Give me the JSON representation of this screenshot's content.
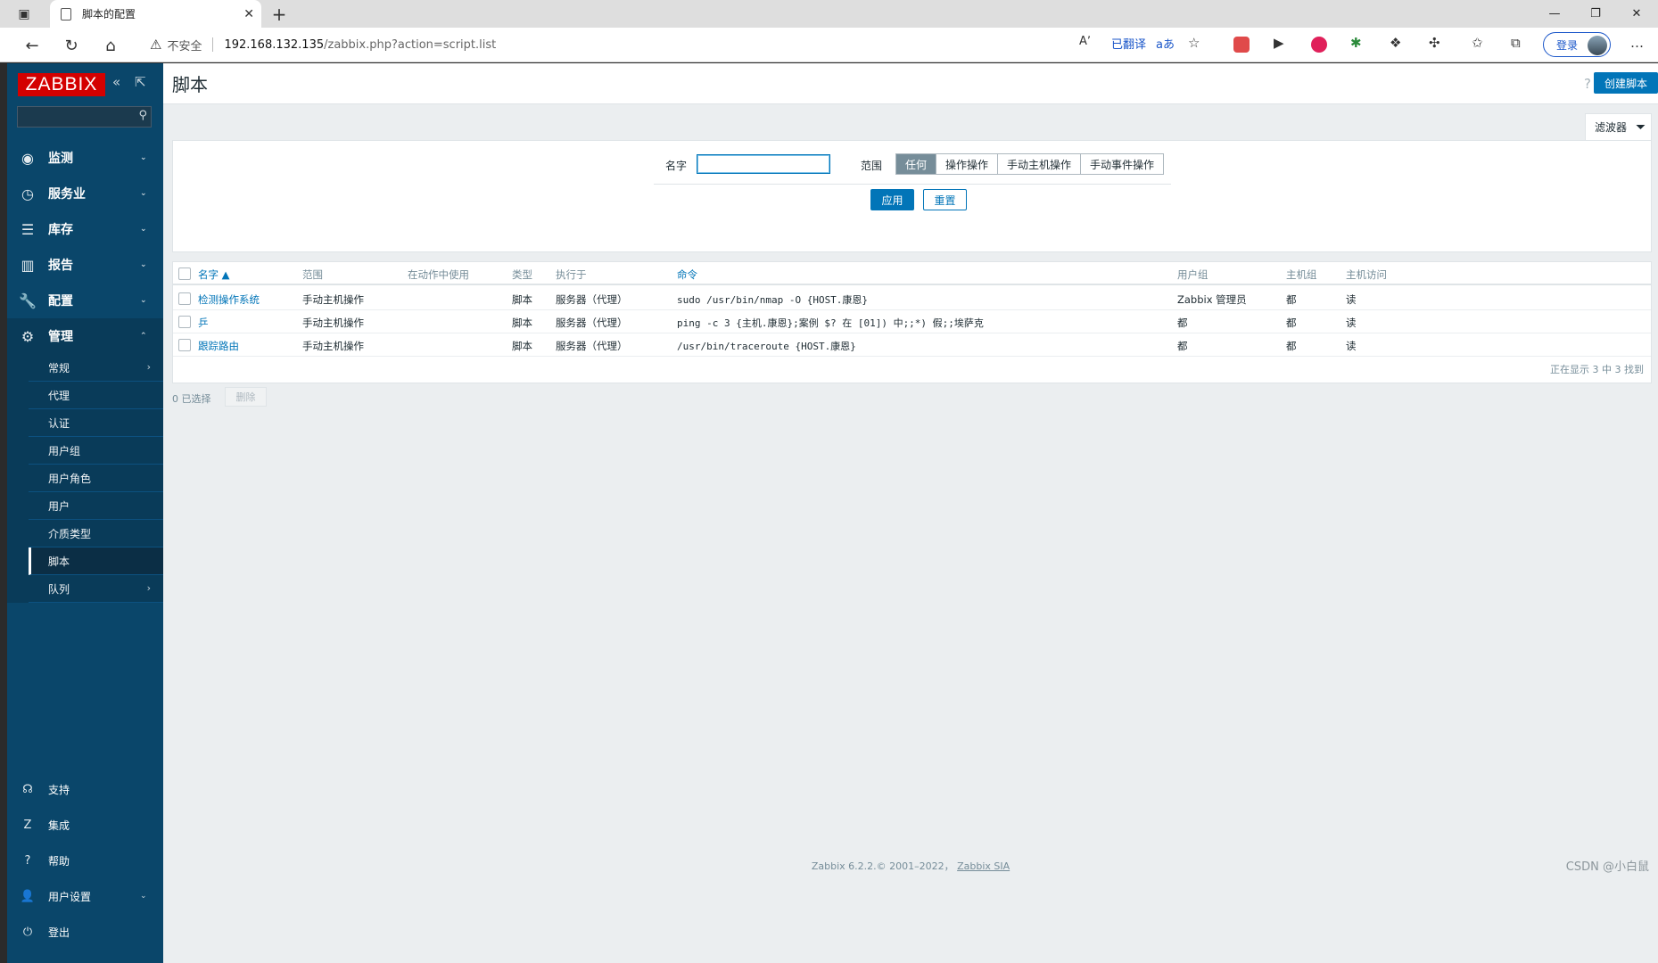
{
  "browser": {
    "tab_title": "脚本的配置",
    "tab_close": "✕",
    "new_tab": "+",
    "insecure_label": "不安全",
    "url_host": "192.168.132.135",
    "url_path": "/zabbix.php?action=script.list",
    "read_aloud": "Á",
    "translated_label": "已翻译",
    "login_label": "登录",
    "controls": {
      "minimize": "—",
      "restore": "❐",
      "close": "✕"
    }
  },
  "sidebar": {
    "logo": "ZABBIX",
    "collapse_icon": "«",
    "kiosk_icon": "⇱",
    "menu": [
      {
        "label": "监测",
        "icon": "eye-icon",
        "glyph": "◉"
      },
      {
        "label": "服务业",
        "icon": "clock-icon",
        "glyph": "◷"
      },
      {
        "label": "库存",
        "icon": "list-icon",
        "glyph": "☰"
      },
      {
        "label": "报告",
        "icon": "bar-chart-icon",
        "glyph": "▥"
      },
      {
        "label": "配置",
        "icon": "wrench-icon",
        "glyph": "🔧"
      },
      {
        "label": "管理",
        "icon": "gear-icon",
        "glyph": "⚙"
      }
    ],
    "submenu": [
      {
        "label": "常规",
        "arrow": "›"
      },
      {
        "label": "代理"
      },
      {
        "label": "认证"
      },
      {
        "label": "用户组"
      },
      {
        "label": "用户角色"
      },
      {
        "label": "用户"
      },
      {
        "label": "介质类型"
      },
      {
        "label": "脚本"
      },
      {
        "label": "队列",
        "arrow": "›"
      }
    ],
    "bottom": [
      {
        "label": "支持",
        "glyph": "☊"
      },
      {
        "label": "集成",
        "glyph": "Z"
      },
      {
        "label": "帮助",
        "glyph": "?"
      },
      {
        "label": "用户设置",
        "glyph": "👤"
      },
      {
        "label": "登出",
        "glyph": "⏻"
      }
    ]
  },
  "header": {
    "title": "脚本",
    "help": "?",
    "create_button": "创建脚本"
  },
  "filter": {
    "tab_label": "滤波器",
    "name_label": "名字",
    "name_value": "",
    "scope_label": "范围",
    "scope_options": [
      "任何",
      "操作操作",
      "手动主机操作",
      "手动事件操作"
    ],
    "apply": "应用",
    "reset": "重置"
  },
  "table": {
    "columns": [
      "名字 ▲",
      "范围",
      "在动作中使用",
      "类型",
      "执行于",
      "命令",
      "用户组",
      "主机组",
      "主机访问"
    ],
    "rows": [
      [
        "检测操作系统",
        "手动主机操作",
        "",
        "脚本",
        "服务器（代理）",
        "sudo /usr/bin/nmap -O {HOST.康恩}",
        "Zabbix 管理员",
        "都",
        "读"
      ],
      [
        "乒",
        "手动主机操作",
        "",
        "脚本",
        "服务器（代理）",
        "ping -c 3 {主机.康恩};案例 $? 在 [01]) 中;;*) 假;;埃萨克",
        "都",
        "都",
        "读"
      ],
      [
        "跟踪路由",
        "手动主机操作",
        "",
        "脚本",
        "服务器（代理）",
        "/usr/bin/traceroute {HOST.康恩}",
        "都",
        "都",
        "读"
      ]
    ],
    "footer": "正在显示 3 中 3 找到"
  },
  "actions": {
    "selected": "0 已选择",
    "delete": "删除"
  },
  "footer": {
    "text": "Zabbix 6.2.2.© 2001–2022，",
    "link": "Zabbix SIA"
  },
  "watermark": "CSDN @小白鼠"
}
